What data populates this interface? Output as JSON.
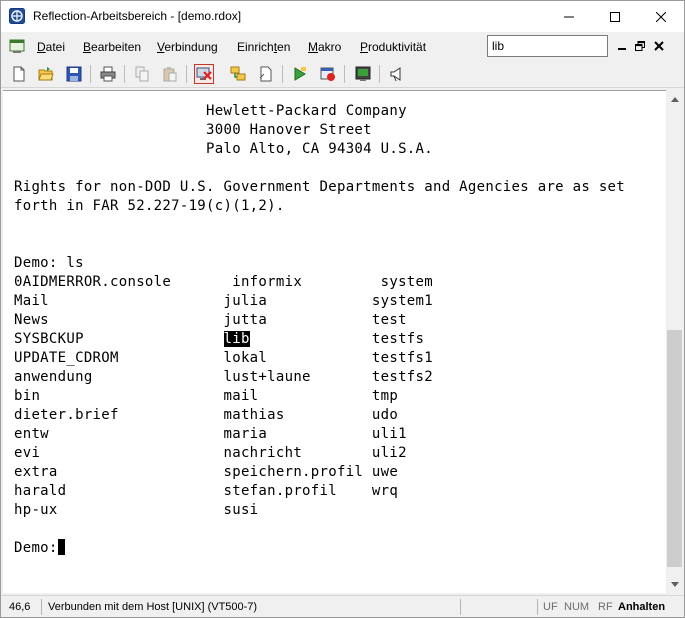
{
  "window": {
    "title": "Reflection-Arbeitsbereich - [demo.rdox]",
    "icon": "reflection-app-icon"
  },
  "menubar": {
    "items": [
      {
        "label": "Datei",
        "underline": "D",
        "rest": "atei"
      },
      {
        "label": "Bearbeiten",
        "underline": "B",
        "rest": "earbeiten"
      },
      {
        "label": "Verbindung",
        "underline": "V",
        "rest": "erbindung"
      },
      {
        "label": "Einrichten",
        "underline": "E",
        "pre": "Einrich",
        "u2": "t",
        "rest2": "en"
      },
      {
        "label": "Makro",
        "underline": "M",
        "rest": "akro"
      },
      {
        "label": "Produktivität",
        "underline": "P",
        "rest": "roduktivität"
      }
    ],
    "search_value": "lib"
  },
  "toolbar": {
    "buttons": [
      "new-icon",
      "open-icon",
      "save-icon",
      "print-icon",
      "copy-icon",
      "paste-icon",
      "disconnect-icon",
      "connect-icon",
      "page-setup-icon",
      "macro-run-icon",
      "macro-stop-icon",
      "capture-icon",
      "announce-icon"
    ]
  },
  "terminal": {
    "lines": [
      {
        "text": "                      Hewlett-Packard Company"
      },
      {
        "text": "                      3000 Hanover Street"
      },
      {
        "text": "                      Palo Alto, CA 94304 U.S.A."
      },
      {
        "text": ""
      },
      {
        "text": "Rights for non-DOD U.S. Government Departments and Agencies are as set"
      },
      {
        "text": "forth in FAR 52.227-19(c)(1,2)."
      },
      {
        "text": ""
      },
      {
        "text": ""
      },
      {
        "text": "Demo: ls"
      },
      {
        "text": "0AIDMERROR.console       informix         system"
      },
      {
        "text": "Mail                    julia            system1"
      },
      {
        "text": "News                    jutta            test"
      },
      {
        "text": "SYSBCKUP                ",
        "hl": "lib",
        "after": "              testfs"
      },
      {
        "text": "UPDATE_CDROM            lokal            testfs1"
      },
      {
        "text": "anwendung               lust+laune       testfs2"
      },
      {
        "text": "bin                     mail             tmp"
      },
      {
        "text": "dieter.brief            mathias          udo"
      },
      {
        "text": "entw                    maria            uli1"
      },
      {
        "text": "evi                     nachricht        uli2"
      },
      {
        "text": "extra                   speichern.profil uwe"
      },
      {
        "text": "harald                  stefan.profil    wrq"
      },
      {
        "text": "hp-ux                   susi"
      },
      {
        "text": ""
      },
      {
        "text": "Demo:",
        "cursor": true
      }
    ]
  },
  "statusbar": {
    "position": "46,6",
    "connection": "Verbunden mit dem Host [UNIX] (VT500-7)",
    "uf": "UF",
    "num": "NUM",
    "rf": "RF",
    "hold": "Anhalten"
  },
  "colors": {
    "terminal_bg": "#ffffff",
    "terminal_fg": "#000000",
    "chrome": "#f0f0f0"
  }
}
